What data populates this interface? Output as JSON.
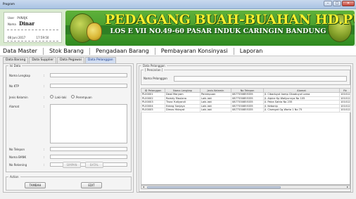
{
  "window": {
    "title": "Program",
    "minimize": "–",
    "maximize": "□",
    "close": "✕"
  },
  "user": {
    "user_label": "User",
    "user_value": "PVNXJK",
    "name_label": "Nama",
    "name_value": "Dinar",
    "date": "08 Juni 2017",
    "time": "17:59:50"
  },
  "banner": {
    "title": "PEDAGANG BUAH-BUAHAN HD.PUTRA",
    "address": "LOS E VII NO.49-60 PASAR INDUK CARINGIN BANDUNG",
    "colors": {
      "green": "#3a9a2a",
      "title": "#f7ef2e"
    }
  },
  "menu": {
    "items": [
      "Data Master",
      "Stok Barang",
      "Pengadaan Barang",
      "Pembayaran Konsinyasi",
      "Laporan"
    ]
  },
  "subtabs": [
    "Data Barang",
    "Data Supplier",
    "Data Pegawai",
    "Data Pelanggan"
  ],
  "form": {
    "group_title": "Isi Data",
    "fields": {
      "nama_lengkap": "Nama Lengkap",
      "no_ktp": "No KTP",
      "jenis_kelamin": "Jenis Kelamin",
      "alamat": "Alamat",
      "no_telepon": "No Telepon",
      "nama_bank": "Nama BANK",
      "no_rekening": "No Rekening"
    },
    "colon": ":",
    "radio_male": "Laki-laki",
    "radio_female": "Perempuan",
    "simpan": "SIMPAN",
    "batal": "BATAL"
  },
  "action": {
    "group_title": "Action",
    "tambah": "TAMBAH",
    "edit": "EDIT"
  },
  "right": {
    "group_title": "Data Pelanggan",
    "search_group": "[ Pencarian ]",
    "search_label": "Nama Pelanggan"
  },
  "table": {
    "columns": [
      "ID Pelanggan",
      "Nama Lengkap",
      "Jenis Kelamin",
      "No Telepon",
      "Alamat",
      "Rk"
    ],
    "rows": [
      [
        "PL00001",
        "Dewi Maryam",
        "Perempuan",
        "0877330855335",
        "Jl. Cibaduyut komp Cibaduyut Lama",
        "1010121"
      ],
      [
        "PL00002",
        "Ramdy Maulana",
        "Laki-laki",
        "0877330855335",
        "Jl. Alpine Kp Waliyunnya No 105",
        "1010121"
      ],
      [
        "PL00003",
        "Tisna Yudiyandi",
        "Laki-laki",
        "0877330855335",
        "Jl. Patra Satria No 235",
        "1010121"
      ],
      [
        "PL00004",
        "Edang Sanjaya",
        "Laki-laki",
        "0877330855335",
        "Jl. Kebonip",
        "1010121"
      ],
      [
        "PL00005",
        "Dimas Hidayat",
        "Laki-laki",
        "0877330855335",
        "Jl. Cisengat Gg Warta 1 No 75",
        "1010121"
      ]
    ]
  }
}
